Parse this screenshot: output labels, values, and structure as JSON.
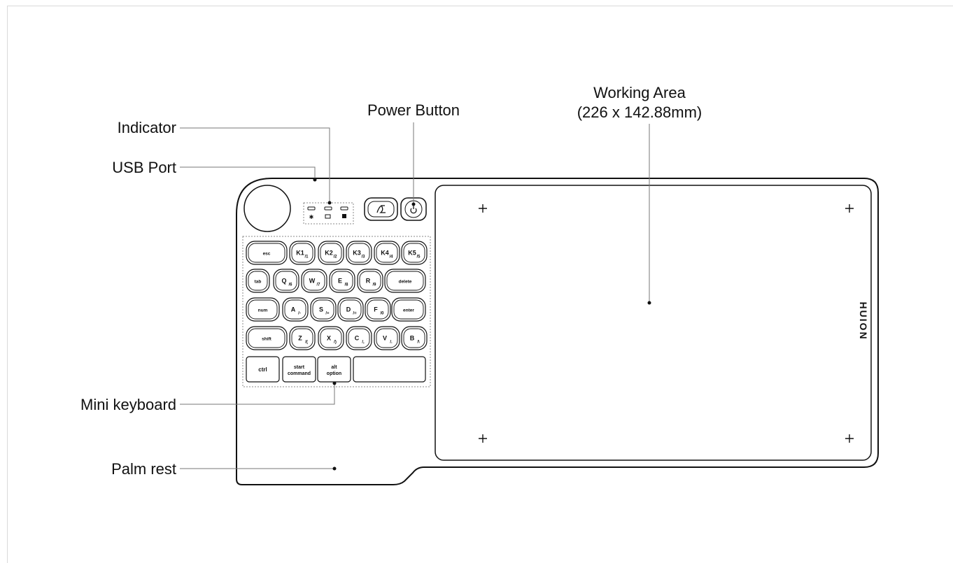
{
  "labels": {
    "indicator": "Indicator",
    "usb_port": "USB Port",
    "power_button": "Power Button",
    "working_area_title": "Working Area",
    "working_area_size": "(226 x 142.88mm)",
    "mini_keyboard": "Mini keyboard",
    "palm_rest": "Palm rest"
  },
  "brand": "HUION",
  "keyboard": {
    "row1": [
      {
        "main": "esc",
        "sub": ""
      },
      {
        "main": "K1",
        "sub": "/1"
      },
      {
        "main": "K2",
        "sub": "/2"
      },
      {
        "main": "K3",
        "sub": "/3"
      },
      {
        "main": "K4",
        "sub": "/4"
      },
      {
        "main": "K5",
        "sub": "/5"
      }
    ],
    "row2": [
      {
        "main": "tab",
        "sub": ""
      },
      {
        "main": "Q",
        "sub": "/6"
      },
      {
        "main": "W",
        "sub": "/7"
      },
      {
        "main": "E",
        "sub": "/8"
      },
      {
        "main": "R",
        "sub": "/9"
      },
      {
        "main": "delete",
        "sub": ""
      }
    ],
    "row3": [
      {
        "main": "num",
        "sub": ""
      },
      {
        "main": "A",
        "sub": "/-"
      },
      {
        "main": "S",
        "sub": "/+"
      },
      {
        "main": "D",
        "sub": "/="
      },
      {
        "main": "F",
        "sub": "/0"
      },
      {
        "main": "enter",
        "sub": ""
      }
    ],
    "row4": [
      {
        "main": "shift",
        "sub": ""
      },
      {
        "main": "Z",
        "sub": "/("
      },
      {
        "main": "X",
        "sub": "/)"
      },
      {
        "main": "C",
        "sub": "/,"
      },
      {
        "main": "V",
        "sub": "/."
      },
      {
        "main": "B",
        "sub": "/\\"
      }
    ],
    "row5": [
      {
        "main": "ctrl",
        "sub": ""
      },
      {
        "main": "start",
        "sub": "command"
      },
      {
        "main": "alt",
        "sub": "option"
      },
      {
        "main": "",
        "sub": ""
      }
    ]
  }
}
